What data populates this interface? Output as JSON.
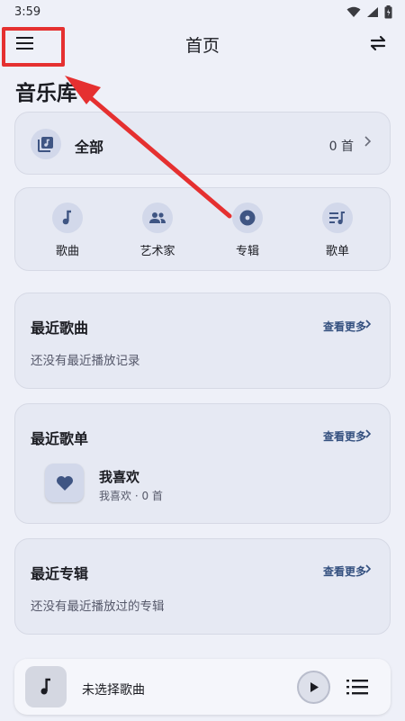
{
  "status_bar": {
    "time": "3:59"
  },
  "header": {
    "title": "首页"
  },
  "library": {
    "title": "音乐库",
    "all": {
      "label": "全部",
      "count": "0 首"
    },
    "categories": [
      {
        "label": "歌曲",
        "icon": "music-note-icon"
      },
      {
        "label": "艺术家",
        "icon": "people-icon"
      },
      {
        "label": "专辑",
        "icon": "disc-icon"
      },
      {
        "label": "歌单",
        "icon": "playlist-icon"
      }
    ]
  },
  "recent_songs": {
    "title": "最近歌曲",
    "more": "查看更多",
    "empty": "还没有最近播放记录"
  },
  "recent_playlists": {
    "title": "最近歌单",
    "more": "查看更多",
    "items": [
      {
        "name": "我喜欢",
        "meta": "我喜欢 · 0 首"
      }
    ]
  },
  "recent_albums": {
    "title": "最近专辑",
    "more": "查看更多",
    "empty": "还没有最近播放过的专辑"
  },
  "player": {
    "text": "未选择歌曲"
  },
  "colors": {
    "accent": "#34507f",
    "annotation": "#e53030",
    "background": "#eef0f8"
  }
}
